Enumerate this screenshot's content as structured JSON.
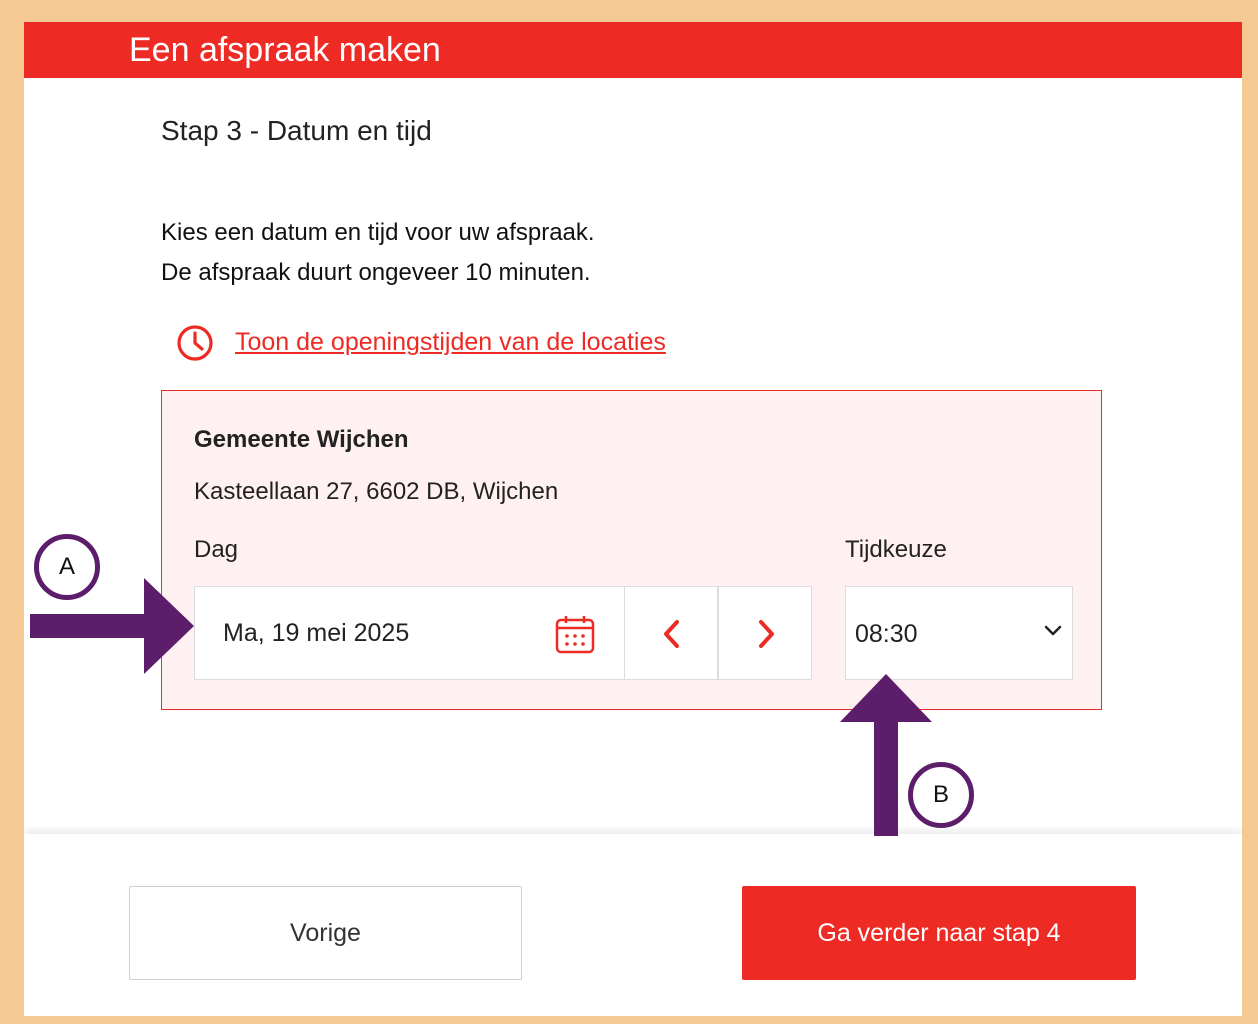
{
  "header": {
    "title": "Een afspraak maken"
  },
  "step": {
    "title": "Stap 3 - Datum en tijd"
  },
  "intro": {
    "line1": "Kies een datum en tijd voor uw afspraak.",
    "line2": "De afspraak duurt ongeveer 10 minuten."
  },
  "opening_hours_link": {
    "label": "Toon de openingstijden van de locaties",
    "icon": "clock-icon"
  },
  "location": {
    "name": "Gemeente Wijchen",
    "address": "Kasteellaan 27, 6602 DB, Wijchen",
    "day_label": "Dag",
    "date_value": "Ma, 19 mei 2025",
    "time_label": "Tijdkeuze",
    "time_value": "08:30"
  },
  "footer": {
    "previous_label": "Vorige",
    "next_label": "Ga verder naar stap 4"
  },
  "annotations": {
    "a": "A",
    "b": "B"
  },
  "colors": {
    "accent": "#ee2a24",
    "card_background": "#fff1f1",
    "frame": "#f5c993",
    "annotation": "#5c1d6b"
  }
}
